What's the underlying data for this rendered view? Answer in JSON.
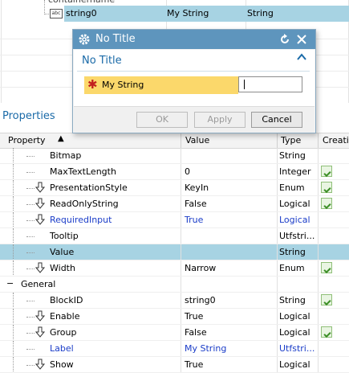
{
  "tree": {
    "partial_label": "containername",
    "node_label": "string0",
    "node_value": "My String",
    "node_type": "String",
    "node_icon": "string-block-icon"
  },
  "properties_title": "Properties",
  "grid": {
    "headers": {
      "property": "Property",
      "value": "Value",
      "type": "Type",
      "creation": "Creatio"
    },
    "rows": [
      {
        "name": "Bitmap",
        "value": "",
        "type": "String"
      },
      {
        "name": "MaxTextLength",
        "value": "0",
        "type": "Integer"
      },
      {
        "name": "PresentationStyle",
        "value": "KeyIn",
        "type": "Enum"
      },
      {
        "name": "ReadOnlyString",
        "value": "False",
        "type": "Logical"
      },
      {
        "name": "RequiredInput",
        "value": "True",
        "type": "Logical"
      },
      {
        "name": "Tooltip",
        "value": "",
        "type": "Utfstri..."
      },
      {
        "name": "Value",
        "value": "",
        "type": "String"
      },
      {
        "name": "Width",
        "value": "Narrow",
        "type": "Enum"
      },
      {
        "name": "General",
        "value": "",
        "type": ""
      },
      {
        "name": "BlockID",
        "value": "string0",
        "type": "String"
      },
      {
        "name": "Enable",
        "value": "True",
        "type": "Logical"
      },
      {
        "name": "Group",
        "value": "False",
        "type": "Logical"
      },
      {
        "name": "Label",
        "value": "My String",
        "type": "Utfstri..."
      },
      {
        "name": "Show",
        "value": "True",
        "type": "Logical"
      }
    ]
  },
  "dialog": {
    "title": "No Title",
    "group_title": "No Title",
    "field_label": "My String",
    "field_value": "",
    "buttons": {
      "ok": "OK",
      "apply": "Apply",
      "cancel": "Cancel"
    }
  },
  "colors": {
    "title_bar": "#5e95bd",
    "selection": "#a7d3e3",
    "required": "#fbd86b",
    "link_blue": "#1a3cc8"
  }
}
